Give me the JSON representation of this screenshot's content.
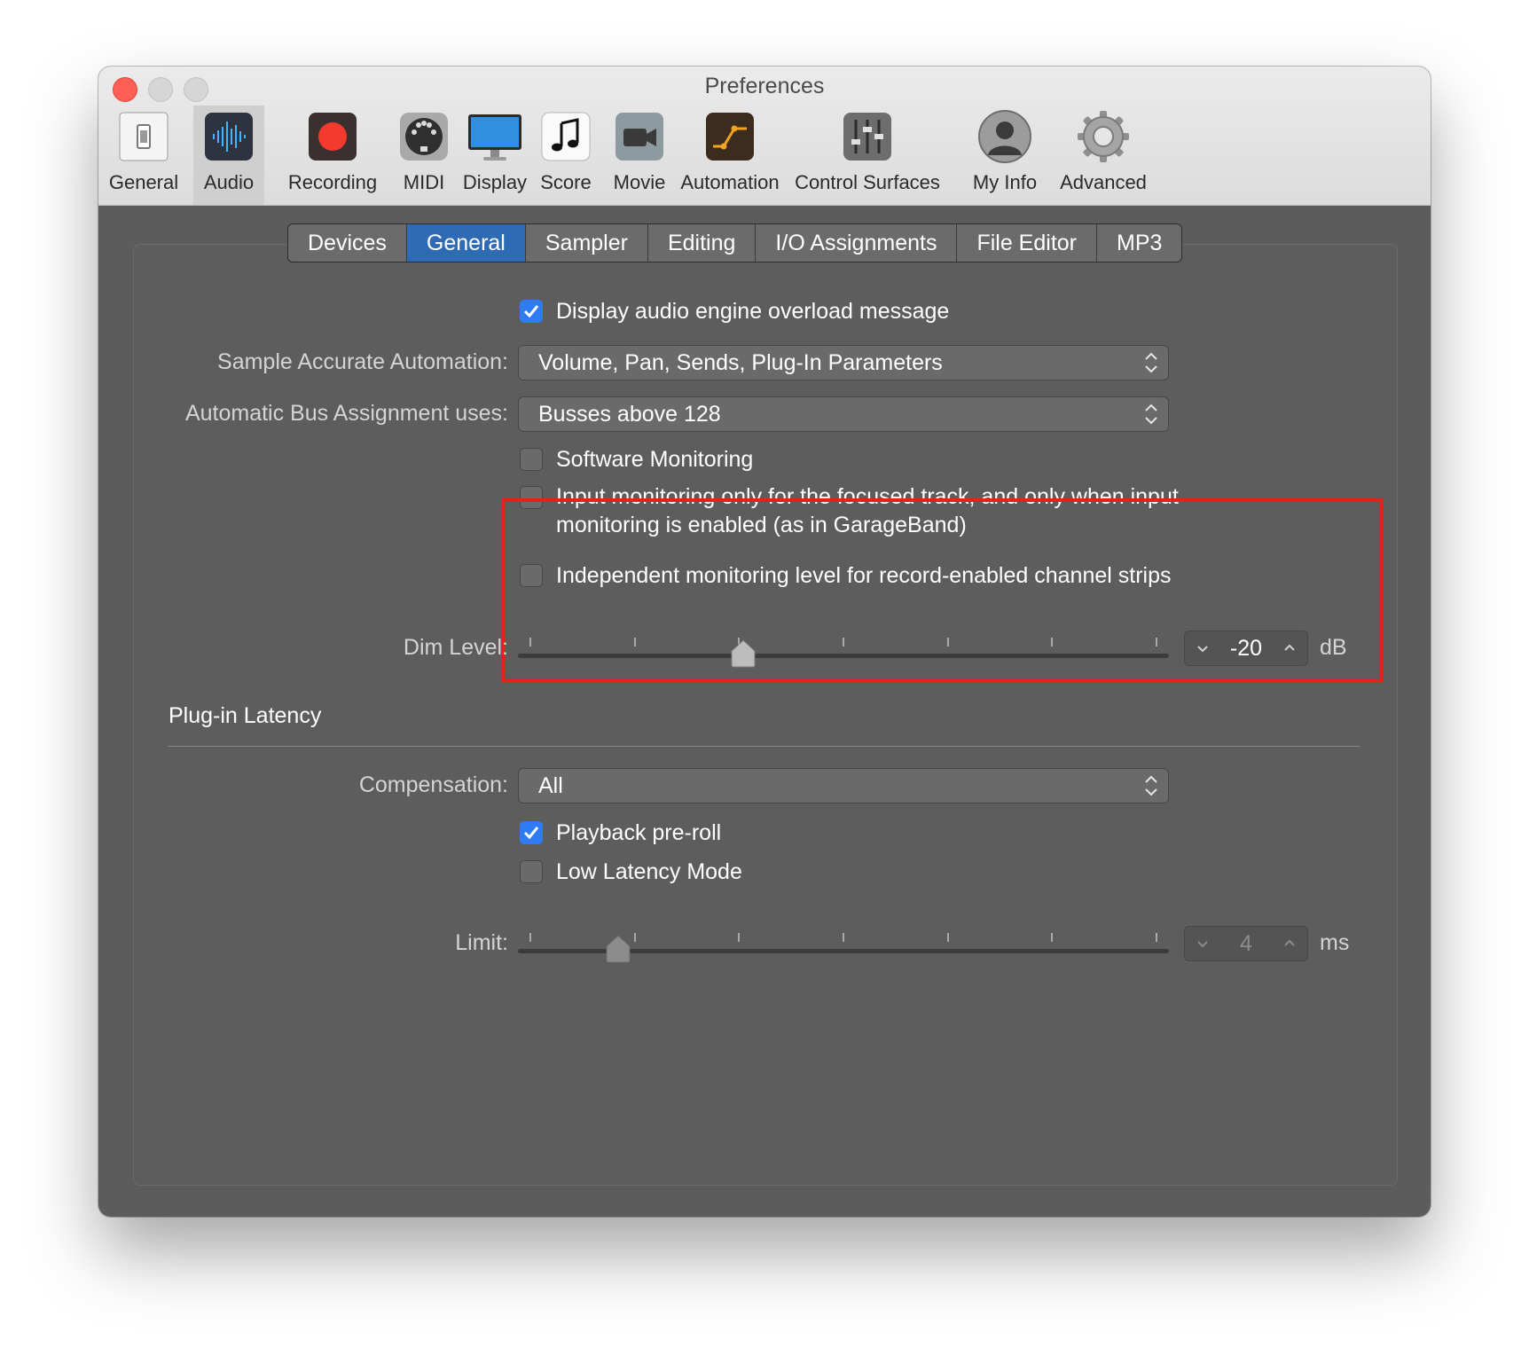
{
  "window": {
    "title": "Preferences"
  },
  "toolbar": {
    "items": [
      {
        "label": "General",
        "icon": "general-switch-icon"
      },
      {
        "label": "Audio",
        "icon": "audio-waveform-icon",
        "selected": true
      },
      {
        "label": "Recording",
        "icon": "record-icon"
      },
      {
        "label": "MIDI",
        "icon": "midi-connector-icon"
      },
      {
        "label": "Display",
        "icon": "display-monitor-icon"
      },
      {
        "label": "Score",
        "icon": "music-note-icon"
      },
      {
        "label": "Movie",
        "icon": "movie-camera-icon"
      },
      {
        "label": "Automation",
        "icon": "automation-curve-icon"
      },
      {
        "label": "Control Surfaces",
        "icon": "faders-icon"
      },
      {
        "label": "My Info",
        "icon": "user-silhouette-icon"
      },
      {
        "label": "Advanced",
        "icon": "gear-icon"
      }
    ]
  },
  "tabs": [
    {
      "label": "Devices"
    },
    {
      "label": "General",
      "active": true
    },
    {
      "label": "Sampler"
    },
    {
      "label": "Editing"
    },
    {
      "label": "I/O Assignments"
    },
    {
      "label": "File Editor"
    },
    {
      "label": "MP3"
    }
  ],
  "general": {
    "overload_message": {
      "label": "Display audio engine overload message",
      "checked": true
    },
    "sample_accurate_automation": {
      "label": "Sample Accurate Automation:",
      "value": "Volume, Pan, Sends, Plug-In Parameters"
    },
    "bus_assignment": {
      "label": "Automatic Bus Assignment uses:",
      "value": "Busses above 128"
    },
    "software_monitoring": {
      "label": "Software Monitoring",
      "checked": false
    },
    "input_monitoring_focused": {
      "label_line1": "Input monitoring only for the focused track, and only when input",
      "label_line2": "monitoring is enabled (as in GarageBand)",
      "checked": false
    },
    "independent_monitoring": {
      "label": "Independent monitoring level for record-enabled channel strips",
      "checked": false
    },
    "dim_level": {
      "label": "Dim Level:",
      "value": "-20",
      "unit": "dB",
      "slider_fraction": 0.34
    }
  },
  "plugin_latency": {
    "title": "Plug-in Latency",
    "compensation": {
      "label": "Compensation:",
      "value": "All"
    },
    "playback_preroll": {
      "label": "Playback pre-roll",
      "checked": true
    },
    "low_latency_mode": {
      "label": "Low Latency Mode",
      "checked": false
    },
    "limit": {
      "label": "Limit:",
      "value": "4",
      "unit": "ms",
      "slider_fraction": 0.14
    }
  },
  "colors": {
    "accent": "#2f6bb5",
    "checkbox_checked": "#2d7cf6",
    "highlight": "#e2231a",
    "close": "#fe5f57"
  }
}
